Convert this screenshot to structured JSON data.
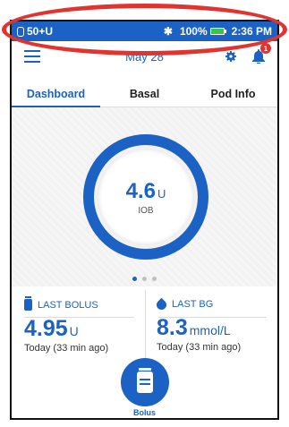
{
  "status_bar": {
    "pod_status": "50+U",
    "bluetooth_icon": "bluetooth-icon",
    "battery_percent": "100%",
    "battery_color": "#3ac24a",
    "time": "2:36 PM"
  },
  "header": {
    "date": "May 28",
    "notification_count": "1"
  },
  "tabs": [
    {
      "label": "Dashboard",
      "active": true
    },
    {
      "label": "Basal",
      "active": false
    },
    {
      "label": "Pod Info",
      "active": false
    }
  ],
  "iob": {
    "value": "4.6",
    "unit": "U",
    "label": "IOB"
  },
  "pager": {
    "count": 3,
    "active_index": 0
  },
  "last_bolus": {
    "title": "LAST BOLUS",
    "value": "4.95",
    "unit": "U",
    "time": "Today (33 min ago)"
  },
  "last_bg": {
    "title": "LAST BG",
    "value": "8.3",
    "unit": "mmol/L",
    "time": "Today (33 min ago)"
  },
  "bolus_button": {
    "label": "Bolus"
  },
  "colors": {
    "accent": "#1b62c4",
    "highlight": "#e2332f"
  }
}
